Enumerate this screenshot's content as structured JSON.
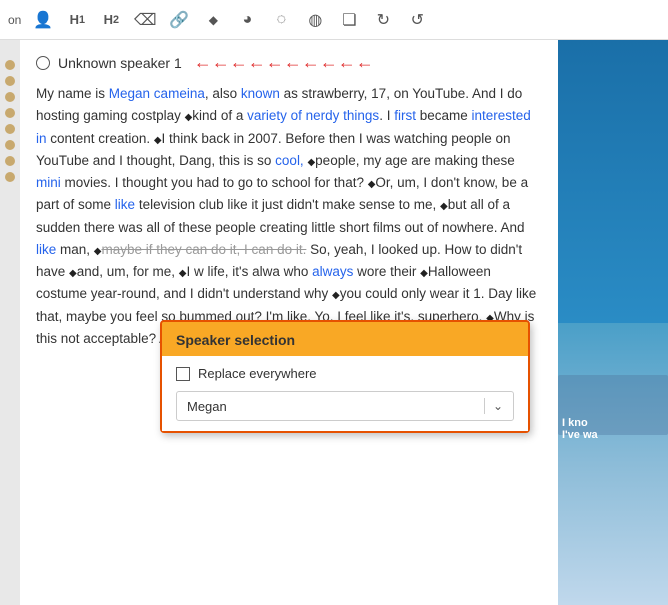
{
  "toolbar": {
    "icons": [
      "person",
      "H1",
      "H2",
      "eraser",
      "link",
      "diamond",
      "clock",
      "loop",
      "loop2",
      "copy",
      "undo",
      "redo"
    ]
  },
  "speaker": {
    "name": "Unknown speaker 1",
    "arrow": "←"
  },
  "transcript": {
    "text": "My name is Megan cameina, also known as strawberry, 17, on YouTube. And I do hosting gaming costplay ◆kind of a variety of nerdy things. I first became interested in content creation. ◆I think back in 2007. Before then I was watching people on YouTube and I thought, Dang, this is so cool, ◆people, my age are making these mini movies. I thought you had to go to school for that? ◆Or, um, I don't know, be a part of some like television club like it just didn't make sense to me, ◆but all of a sudden there was all of these people creating little short films out of nowhere. And like man, ◆maybe if they can do it, I can do it. So, yeah, I looked up. How to didn't have ◆and, um, for me, ◆I w life, it's alwa who always wore their ◆Halloween costume year-round, and I didn't understand why ◆you could only wear it 1. Day like that, maybe you feel so bummed out? I'm like, Yo, I feel like it's, superhero. ◆Why is this not acceptable? And I"
  },
  "popup": {
    "title": "Speaker selection",
    "checkbox_label": "Replace everywhere",
    "checked": false,
    "selected_speaker": "Megan"
  },
  "right_panel": {
    "text_line1": "I kno",
    "text_line2": "I've wa"
  }
}
